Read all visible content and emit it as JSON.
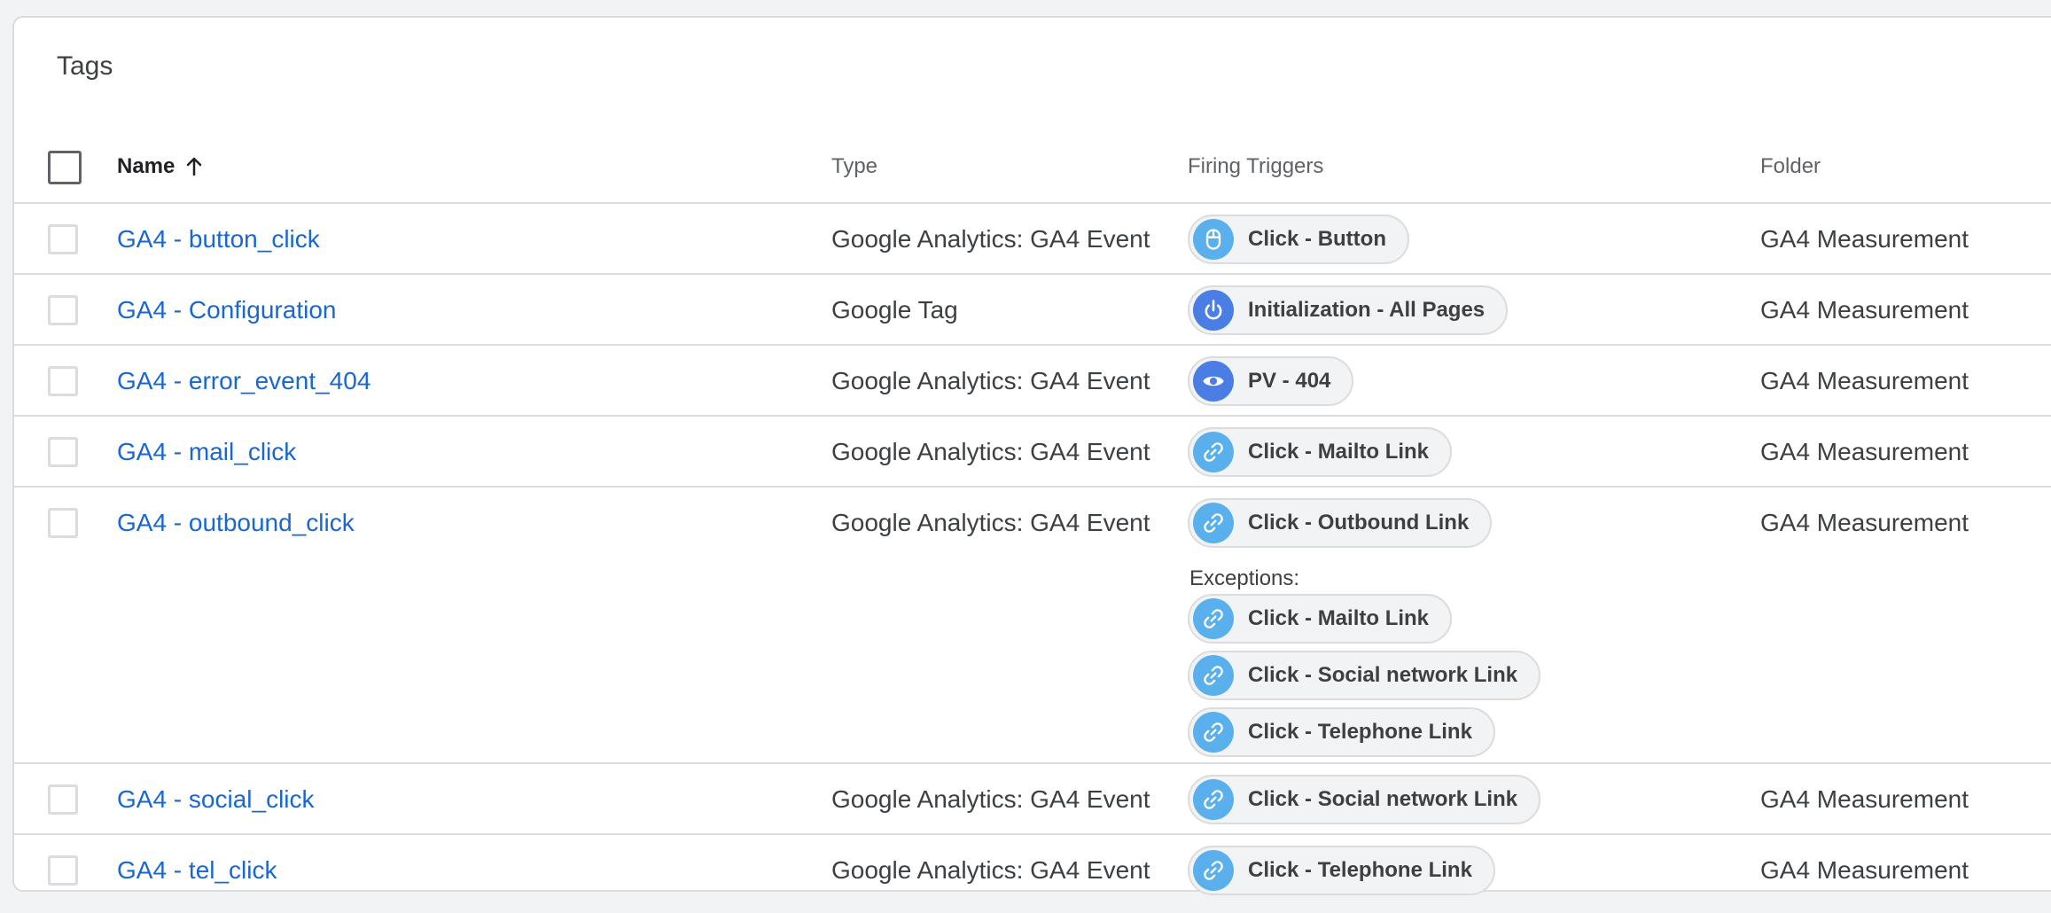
{
  "card": {
    "title": "Tags"
  },
  "columns": {
    "name": "Name",
    "type": "Type",
    "triggers": "Firing Triggers",
    "folder": "Folder"
  },
  "colors": {
    "link": "#1967d2",
    "click_icon": "#5ab0ec",
    "init_icon": "#4a7ee4",
    "pageview_icon": "#4a7ee4"
  },
  "rows": [
    {
      "name": "GA4 - button_click",
      "type": "Google Analytics: GA4 Event",
      "trigger": {
        "label": "Click - Button",
        "icon": "mouse-icon"
      },
      "folder": "GA4 Measurement"
    },
    {
      "name": "GA4 - Configuration",
      "type": "Google Tag",
      "trigger": {
        "label": "Initialization - All Pages",
        "icon": "power-icon"
      },
      "folder": "GA4 Measurement"
    },
    {
      "name": "GA4 - error_event_404",
      "type": "Google Analytics: GA4 Event",
      "trigger": {
        "label": "PV - 404",
        "icon": "eye-icon"
      },
      "folder": "GA4 Measurement"
    },
    {
      "name": "GA4 - mail_click",
      "type": "Google Analytics: GA4 Event",
      "trigger": {
        "label": "Click - Mailto Link",
        "icon": "link-icon"
      },
      "folder": "GA4 Measurement"
    },
    {
      "name": "GA4 - outbound_click",
      "type": "Google Analytics: GA4 Event",
      "trigger": {
        "label": "Click - Outbound Link",
        "icon": "link-icon"
      },
      "exceptions_label": "Exceptions:",
      "exceptions": [
        {
          "label": "Click - Mailto Link",
          "icon": "link-icon"
        },
        {
          "label": "Click - Social network Link",
          "icon": "link-icon"
        },
        {
          "label": "Click - Telephone Link",
          "icon": "link-icon"
        }
      ],
      "folder": "GA4 Measurement"
    },
    {
      "name": "GA4 - social_click",
      "type": "Google Analytics: GA4 Event",
      "trigger": {
        "label": "Click - Social network Link",
        "icon": "link-icon"
      },
      "folder": "GA4 Measurement"
    },
    {
      "name": "GA4 - tel_click",
      "type": "Google Analytics: GA4 Event",
      "trigger": {
        "label": "Click - Telephone Link",
        "icon": "link-icon"
      },
      "folder": "GA4 Measurement"
    }
  ]
}
